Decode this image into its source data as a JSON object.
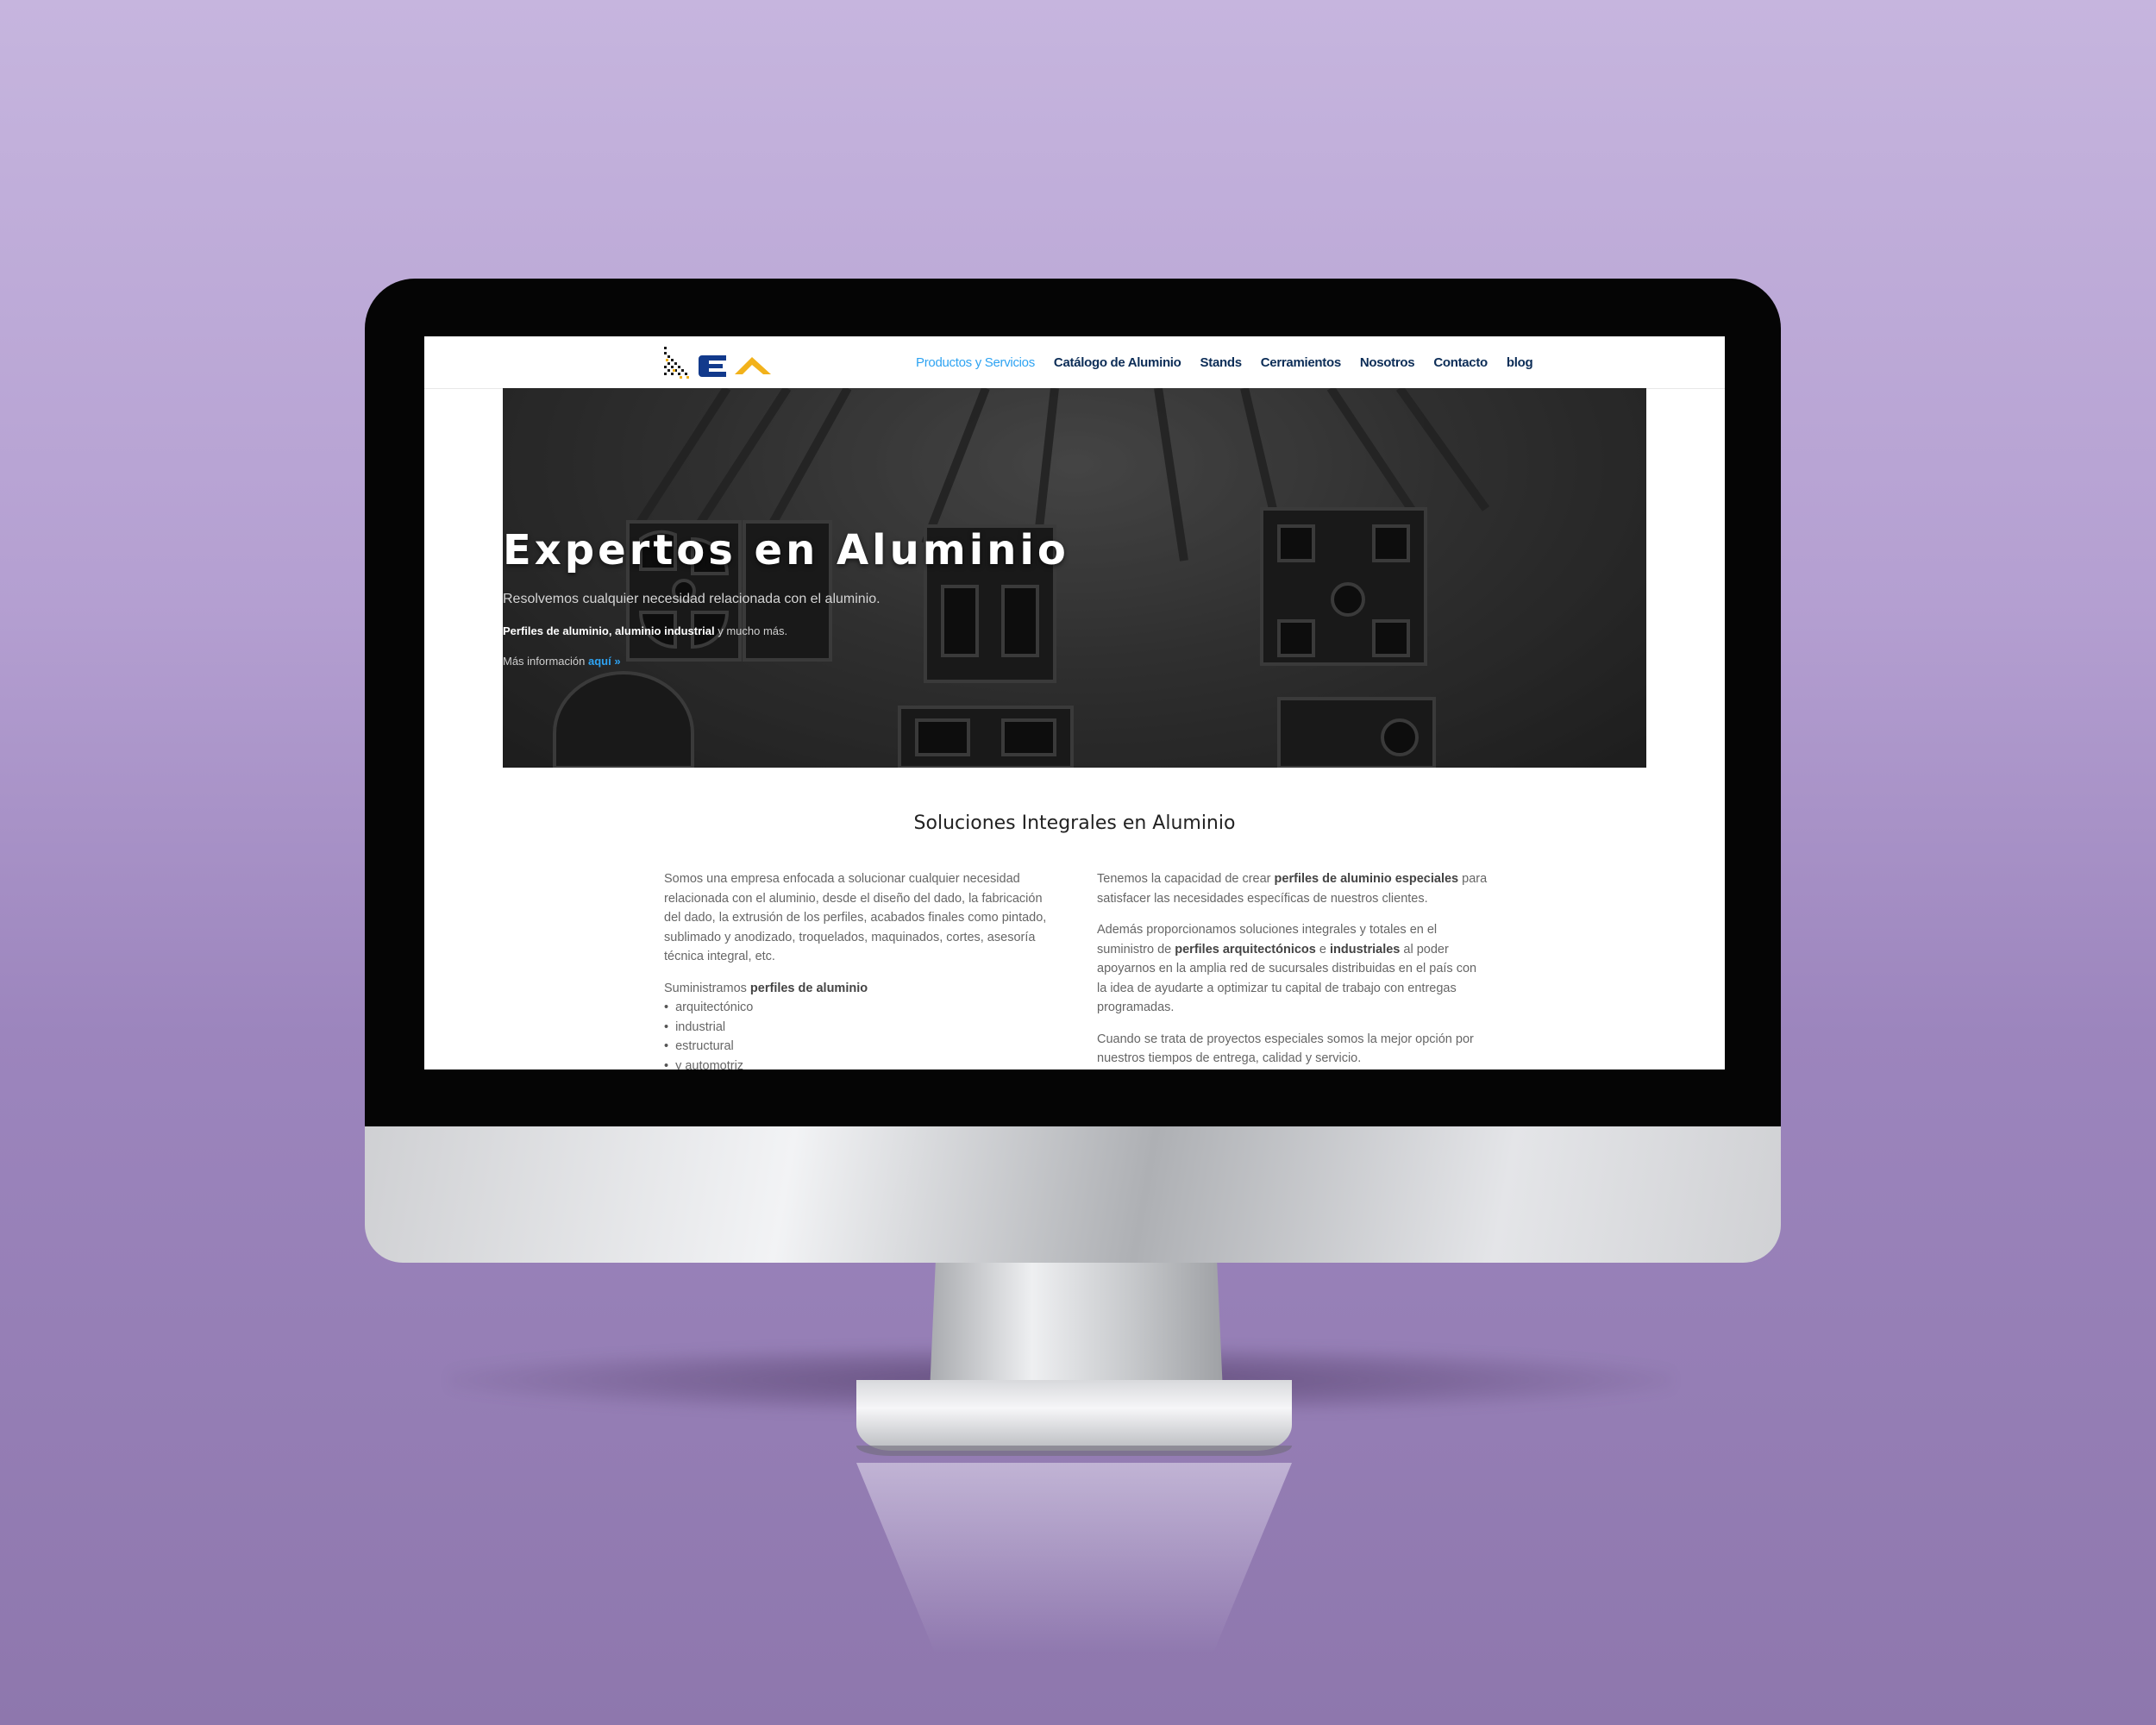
{
  "nav": {
    "items": [
      {
        "label": "Productos y Servicios",
        "active": true
      },
      {
        "label": "Catálogo de Aluminio",
        "active": false
      },
      {
        "label": "Stands",
        "active": false
      },
      {
        "label": "Cerramientos",
        "active": false
      },
      {
        "label": "Nosotros",
        "active": false
      },
      {
        "label": "Contacto",
        "active": false
      },
      {
        "label": "blog",
        "active": false
      }
    ]
  },
  "hero": {
    "title": "Expertos en Aluminio",
    "subtitle": "Resolvemos cualquier necesidad relacionada con el aluminio.",
    "line2_bold": "Perfiles de aluminio, aluminio industrial",
    "line2_rest": " y mucho más.",
    "line3_text": "Más información ",
    "line3_link": "aquí »"
  },
  "section": {
    "title": "Soluciones Integrales en Aluminio",
    "left": {
      "p1": "Somos una empresa enfocada a solucionar cualquier necesidad relacionada con el aluminio, desde el diseño del dado, la fabricación del dado, la extrusión de los perfiles, acabados finales como pintado, sublimado y anodizado, troquelados, maquinados, cortes, asesoría técnica integral, etc.",
      "p2_text": "Suministramos ",
      "p2_bold": "perfiles de aluminio",
      "list": [
        "arquitectónico",
        "industrial",
        "estructural",
        "y automotriz"
      ]
    },
    "right": {
      "p1_text": "Tenemos la capacidad de crear ",
      "p1_bold": "perfiles de aluminio especiales",
      "p1_rest": " para satisfacer las necesidades específicas de nuestros clientes.",
      "p2_text": "Además proporcionamos soluciones integrales y totales en el suministro de ",
      "p2_bold1": "perfiles arquitectónicos",
      "p2_mid": " e ",
      "p2_bold2": "industriales",
      "p2_rest": " al poder apoyarnos en la amplia red de sucursales distribuidas en el país con la idea de ayudarte a optimizar tu capital de trabajo con entregas programadas.",
      "p3": "Cuando se trata de proyectos especiales somos la mejor opción por nuestros tiempos de entrega, calidad y servicio."
    }
  },
  "colors": {
    "nav_text": "#0c2d57",
    "nav_active": "#2ea3f2",
    "logo_blue": "#123a8c",
    "logo_yellow": "#f2b21b",
    "background": "#b49fd1"
  }
}
